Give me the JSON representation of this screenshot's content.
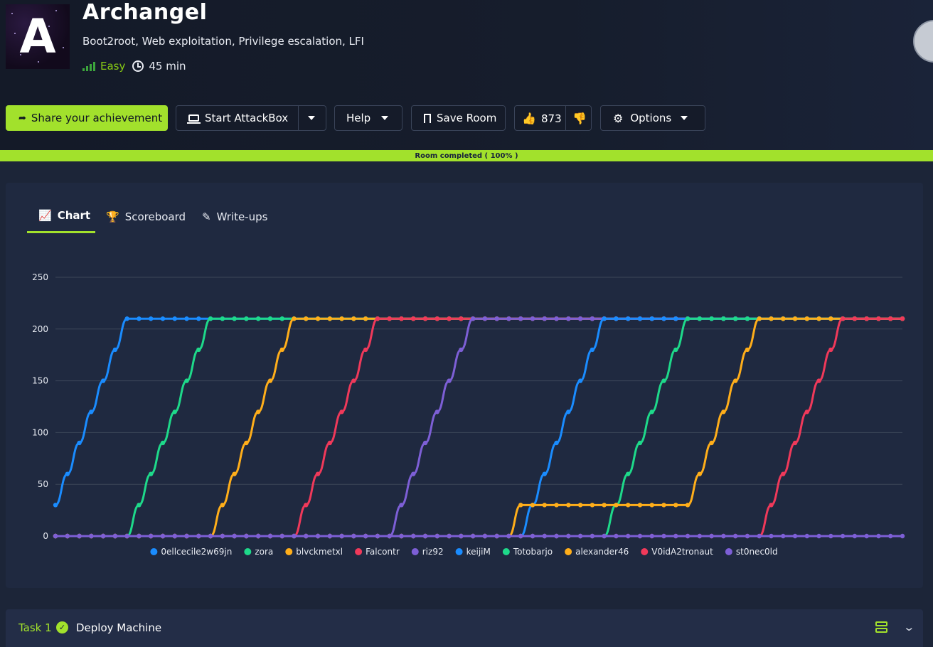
{
  "room": {
    "title": "Archangel",
    "tags": "Boot2root, Web exploitation, Privilege escalation, LFI",
    "difficulty": "Easy",
    "duration": "45 min",
    "logo_letter": "A"
  },
  "toolbar": {
    "share_label": "Share your achievement",
    "attackbox_label": "Start AttackBox",
    "help_label": "Help",
    "save_label": "Save Room",
    "upvotes": "873",
    "options_label": "Options"
  },
  "progress": {
    "label": "Room completed ( 100% )",
    "value": 100
  },
  "tabs": {
    "chart": "Chart",
    "scoreboard": "Scoreboard",
    "writeups": "Write-ups"
  },
  "task": {
    "number": "Task 1",
    "title": "Deploy Machine"
  },
  "colors": {
    "accent": "#a2e12c",
    "background": "#1c2538",
    "panel": "#1f2940"
  },
  "chart_data": {
    "type": "line",
    "ylim": [
      0,
      250
    ],
    "yticks": [
      0,
      50,
      100,
      150,
      200,
      250
    ],
    "x": [
      1,
      2,
      3,
      4,
      5,
      6,
      7,
      8,
      9,
      10,
      11,
      12,
      13,
      14,
      15,
      16,
      17,
      18,
      19,
      20,
      21,
      22,
      23,
      24,
      25,
      26,
      27,
      28,
      29,
      30,
      31,
      32,
      33,
      34,
      35,
      36,
      37,
      38,
      39,
      40,
      41,
      42,
      43,
      44,
      45,
      46,
      47,
      48,
      49,
      50,
      51,
      52,
      53,
      54,
      55,
      56,
      57,
      58,
      59,
      60,
      61,
      62,
      63,
      64,
      65,
      66,
      67,
      68,
      69,
      70,
      71,
      72
    ],
    "series": [
      {
        "name": "0ellcecile2w69jn",
        "color": "#1a8cff",
        "values": [
          30,
          60,
          90,
          120,
          150,
          180,
          210,
          210,
          210,
          210,
          210,
          210,
          210,
          210,
          210,
          210,
          210,
          210,
          210,
          210,
          210,
          210,
          210,
          210,
          210,
          210,
          210,
          210,
          210,
          210,
          210,
          210,
          210,
          210,
          210,
          210,
          210,
          210,
          210,
          210,
          210,
          210,
          210,
          210,
          210,
          210,
          210,
          210,
          210,
          210,
          210,
          210,
          210,
          210,
          210,
          210,
          210,
          210,
          210,
          210,
          210,
          210,
          210,
          210,
          210,
          210,
          210,
          210,
          210,
          210,
          210,
          210
        ]
      },
      {
        "name": "zora",
        "color": "#1ed98a",
        "values": [
          0,
          0,
          0,
          0,
          0,
          0,
          0,
          30,
          60,
          90,
          120,
          150,
          180,
          210,
          210,
          210,
          210,
          210,
          210,
          210,
          210,
          210,
          210,
          210,
          210,
          210,
          210,
          210,
          210,
          210,
          210,
          210,
          210,
          210,
          210,
          210,
          210,
          210,
          210,
          210,
          210,
          210,
          210,
          210,
          210,
          210,
          210,
          210,
          210,
          210,
          210,
          210,
          210,
          210,
          210,
          210,
          210,
          210,
          210,
          210,
          210,
          210,
          210,
          210,
          210,
          210,
          210,
          210,
          210,
          210,
          210,
          210
        ]
      },
      {
        "name": "blvckmetxl",
        "color": "#ffae1a",
        "values": [
          0,
          0,
          0,
          0,
          0,
          0,
          0,
          0,
          0,
          0,
          0,
          0,
          0,
          0,
          30,
          60,
          90,
          120,
          150,
          180,
          210,
          210,
          210,
          210,
          210,
          210,
          210,
          210,
          210,
          210,
          210,
          210,
          210,
          210,
          210,
          210,
          210,
          210,
          210,
          210,
          210,
          210,
          210,
          210,
          210,
          210,
          210,
          210,
          210,
          210,
          210,
          210,
          210,
          210,
          210,
          210,
          210,
          210,
          210,
          210,
          210,
          210,
          210,
          210,
          210,
          210,
          210,
          210,
          210,
          210,
          210,
          210
        ]
      },
      {
        "name": "Falcontr",
        "color": "#f0395a",
        "values": [
          0,
          0,
          0,
          0,
          0,
          0,
          0,
          0,
          0,
          0,
          0,
          0,
          0,
          0,
          0,
          0,
          0,
          0,
          0,
          0,
          0,
          30,
          60,
          90,
          120,
          150,
          180,
          210,
          210,
          210,
          210,
          210,
          210,
          210,
          210,
          210,
          210,
          210,
          210,
          210,
          210,
          210,
          210,
          210,
          210,
          210,
          210,
          210,
          210,
          210,
          210,
          210,
          210,
          210,
          210,
          210,
          210,
          210,
          210,
          210,
          210,
          210,
          210,
          210,
          210,
          210,
          210,
          210,
          210,
          210,
          210,
          210
        ]
      },
      {
        "name": "riz92",
        "color": "#7d5fd6",
        "values": [
          0,
          0,
          0,
          0,
          0,
          0,
          0,
          0,
          0,
          0,
          0,
          0,
          0,
          0,
          0,
          0,
          0,
          0,
          0,
          0,
          0,
          0,
          0,
          0,
          0,
          0,
          0,
          0,
          0,
          30,
          60,
          90,
          120,
          150,
          180,
          210,
          210,
          210,
          210,
          210,
          210,
          210,
          210,
          210,
          210,
          210,
          210,
          210,
          210,
          210,
          210,
          210,
          210,
          210,
          210,
          210,
          210,
          210,
          210,
          210,
          210,
          210,
          210,
          210,
          210,
          210,
          210,
          210,
          210,
          210,
          210,
          210
        ]
      },
      {
        "name": "keijiM",
        "color": "#1a8cff",
        "values": [
          0,
          0,
          0,
          0,
          0,
          0,
          0,
          0,
          0,
          0,
          0,
          0,
          0,
          0,
          0,
          0,
          0,
          0,
          0,
          0,
          0,
          0,
          0,
          0,
          0,
          0,
          0,
          0,
          0,
          0,
          0,
          0,
          0,
          0,
          0,
          0,
          0,
          0,
          0,
          0,
          30,
          60,
          90,
          120,
          150,
          180,
          210,
          210,
          210,
          210,
          210,
          210,
          210,
          210,
          210,
          210,
          210,
          210,
          210,
          210,
          210,
          210,
          210,
          210,
          210,
          210,
          210,
          210,
          210,
          210,
          210,
          210
        ]
      },
      {
        "name": "Totobarjo",
        "color": "#1ed98a",
        "values": [
          0,
          0,
          0,
          0,
          0,
          0,
          0,
          0,
          0,
          0,
          0,
          0,
          0,
          0,
          0,
          0,
          0,
          0,
          0,
          0,
          0,
          0,
          0,
          0,
          0,
          0,
          0,
          0,
          0,
          0,
          0,
          0,
          0,
          0,
          0,
          0,
          0,
          0,
          0,
          0,
          0,
          0,
          0,
          0,
          0,
          0,
          0,
          30,
          60,
          90,
          120,
          150,
          180,
          210,
          210,
          210,
          210,
          210,
          210,
          210,
          210,
          210,
          210,
          210,
          210,
          210,
          210,
          210,
          210,
          210,
          210,
          210
        ]
      },
      {
        "name": "alexander46",
        "color": "#ffae1a",
        "values": [
          0,
          0,
          0,
          0,
          0,
          0,
          0,
          0,
          0,
          0,
          0,
          0,
          0,
          0,
          0,
          0,
          0,
          0,
          0,
          0,
          0,
          0,
          0,
          0,
          0,
          0,
          0,
          0,
          0,
          0,
          0,
          0,
          0,
          0,
          0,
          0,
          0,
          0,
          0,
          30,
          30,
          30,
          30,
          30,
          30,
          30,
          30,
          30,
          30,
          30,
          30,
          30,
          30,
          30,
          60,
          90,
          120,
          150,
          180,
          210,
          210,
          210,
          210,
          210,
          210,
          210,
          210,
          210,
          210,
          210,
          210,
          210
        ]
      },
      {
        "name": "V0idA2tronaut",
        "color": "#f0395a",
        "values": [
          0,
          0,
          0,
          0,
          0,
          0,
          0,
          0,
          0,
          0,
          0,
          0,
          0,
          0,
          0,
          0,
          0,
          0,
          0,
          0,
          0,
          0,
          0,
          0,
          0,
          0,
          0,
          0,
          0,
          0,
          0,
          0,
          0,
          0,
          0,
          0,
          0,
          0,
          0,
          0,
          0,
          0,
          0,
          0,
          0,
          0,
          0,
          0,
          0,
          0,
          0,
          0,
          0,
          0,
          0,
          0,
          0,
          0,
          0,
          0,
          30,
          60,
          90,
          120,
          150,
          180,
          210,
          210,
          210,
          210,
          210,
          210
        ]
      },
      {
        "name": "st0nec0ld",
        "color": "#7d5fd6",
        "values": [
          0,
          0,
          0,
          0,
          0,
          0,
          0,
          0,
          0,
          0,
          0,
          0,
          0,
          0,
          0,
          0,
          0,
          0,
          0,
          0,
          0,
          0,
          0,
          0,
          0,
          0,
          0,
          0,
          0,
          0,
          0,
          0,
          0,
          0,
          0,
          0,
          0,
          0,
          0,
          0,
          0,
          0,
          0,
          0,
          0,
          0,
          0,
          0,
          0,
          0,
          0,
          0,
          0,
          0,
          0,
          0,
          0,
          0,
          0,
          0,
          0,
          0,
          0,
          0,
          0,
          0,
          0,
          0,
          0,
          0,
          0,
          0
        ]
      }
    ],
    "grid": true,
    "legend": "bottom"
  }
}
